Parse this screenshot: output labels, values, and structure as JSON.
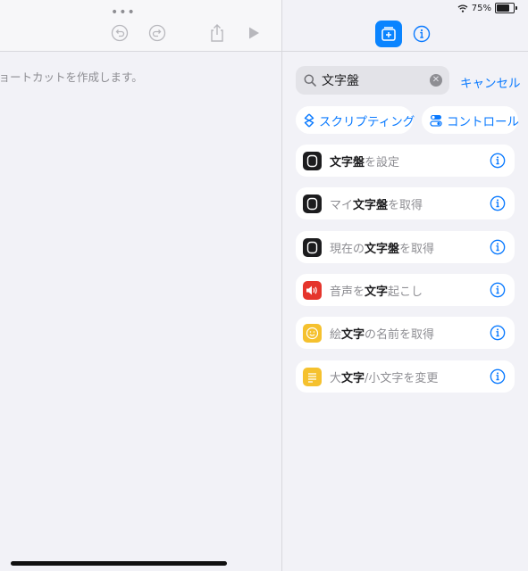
{
  "status": {
    "battery": "75%",
    "battery_level": 0.75
  },
  "editor": {
    "hint": "ショートカットを作成します。"
  },
  "search": {
    "query": "文字盤",
    "cancel": "キャンセル"
  },
  "categories": [
    {
      "label": "スクリプティング",
      "icon": "scripting-icon"
    },
    {
      "label": "コントロール",
      "icon": "control-icon"
    }
  ],
  "actions": [
    {
      "pre": "",
      "hl": "文字盤",
      "post": "を設定",
      "icon": "watch-face-icon",
      "color": "#1c1c1e"
    },
    {
      "pre": "マイ",
      "hl": "文字盤",
      "post": "を取得",
      "icon": "watch-face-icon",
      "color": "#1c1c1e"
    },
    {
      "pre": "現在の",
      "hl": "文字盤",
      "post": "を取得",
      "icon": "watch-face-icon",
      "color": "#1c1c1e"
    },
    {
      "pre": "音声を",
      "hl": "文字",
      "post": "起こし",
      "icon": "speaker-icon",
      "color": "#e5352c"
    },
    {
      "pre": "絵",
      "hl": "文字",
      "post": "の名前を取得",
      "icon": "smiley-icon",
      "color": "#f5c12e"
    },
    {
      "pre": "大",
      "hl": "文字",
      "post": "/小文字を変更",
      "icon": "text-lines-icon",
      "color": "#f5c12e"
    }
  ],
  "colors": {
    "accent": "#0a7aff",
    "background": "#f2f2f7"
  }
}
